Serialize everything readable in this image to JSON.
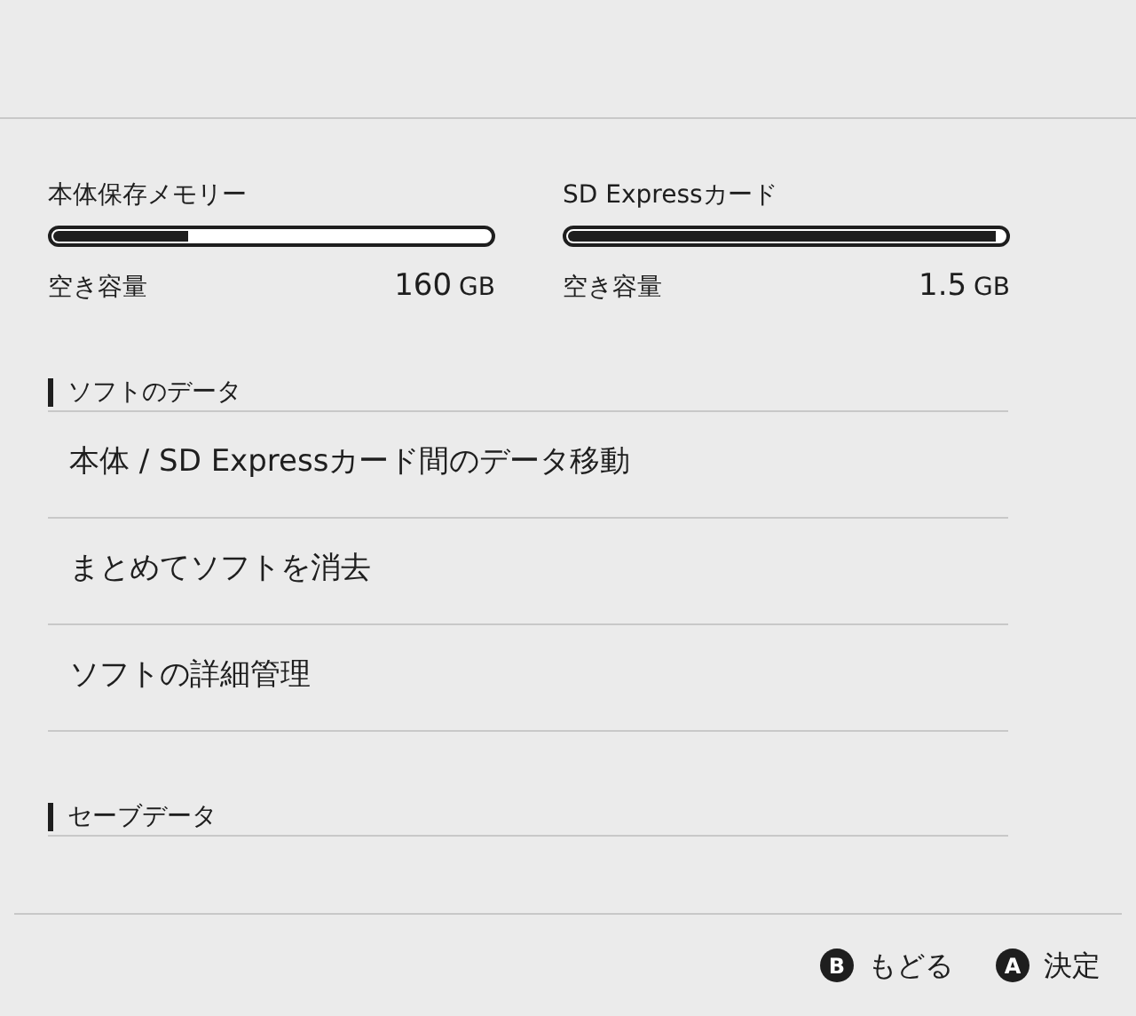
{
  "storage": [
    {
      "name": "本体保存メモリー",
      "level": 0.31,
      "free_label": "空き容量",
      "amount": "160",
      "unit": "GB"
    },
    {
      "name": "SD Expressカード",
      "level": 0.98,
      "free_label": "空き容量",
      "amount": "1.5",
      "unit": "GB"
    }
  ],
  "sections": [
    {
      "title": "ソフトのデータ",
      "items": [
        "本体 / SD Expressカード間のデータ移動",
        "まとめてソフトを消去",
        "ソフトの詳細管理"
      ]
    },
    {
      "title": "セーブデータ"
    }
  ],
  "footer": [
    {
      "key": "B",
      "label": "もどる"
    },
    {
      "key": "A",
      "label": "決定"
    }
  ]
}
